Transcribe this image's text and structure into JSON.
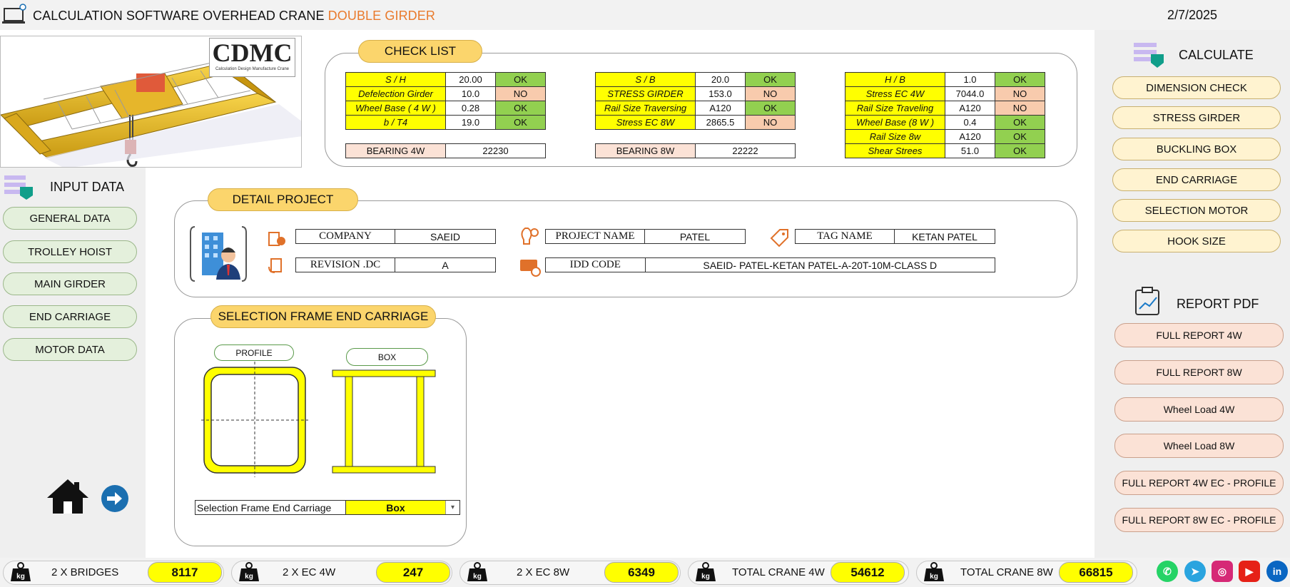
{
  "header": {
    "title_main": "CALCULATION SOFTWARE OVERHEAD CRANE ",
    "title_accent": "DOUBLE GIRDER",
    "date": "2/7/2025",
    "logo_text": "CDMC",
    "logo_subtext": "Calculation Design Manufacture Crane"
  },
  "checklist": {
    "heading": "CHECK LIST",
    "table1": [
      {
        "label": "S / H",
        "value": "20.00",
        "status": "OK"
      },
      {
        "label": "Defelection Girder",
        "value": "10.0",
        "status": "NO"
      },
      {
        "label": "Wheel Base ( 4 W )",
        "value": "0.28",
        "status": "OK"
      },
      {
        "label": "b / T4",
        "value": "19.0",
        "status": "OK"
      }
    ],
    "table2": [
      {
        "label": "S / B",
        "value": "20.0",
        "status": "OK"
      },
      {
        "label": "STRESS GIRDER",
        "value": "153.0",
        "status": "NO"
      },
      {
        "label": "Rail Size Traversing",
        "value": "A120",
        "status": "OK"
      },
      {
        "label": "Stress EC   8W",
        "value": "2865.5",
        "status": "NO"
      }
    ],
    "table3": [
      {
        "label": "H / B",
        "value": "1.0",
        "status": "OK"
      },
      {
        "label": "Stress EC   4W",
        "value": "7044.0",
        "status": "NO"
      },
      {
        "label": "Rail Size Traveling",
        "value": "A120",
        "status": "NO"
      },
      {
        "label": "Wheel Base (8 W )",
        "value": "0.4",
        "status": "OK"
      },
      {
        "label": "Rail Size 8w",
        "value": "A120",
        "status": "OK"
      },
      {
        "label": "Shear Strees",
        "value": "51.0",
        "status": "OK"
      }
    ],
    "bearing4w": {
      "label": "BEARING 4W",
      "value": "22230"
    },
    "bearing8w": {
      "label": "BEARING 8W",
      "value": "22222"
    }
  },
  "input_data": {
    "heading": "INPUT DATA",
    "buttons": [
      "GENERAL DATA",
      "TROLLEY HOIST",
      "MAIN GIRDER",
      "END CARRIAGE",
      "MOTOR DATA"
    ]
  },
  "calculate": {
    "heading": "CALCULATE",
    "buttons": [
      "DIMENSION CHECK",
      "STRESS GIRDER",
      "BUCKLING BOX",
      "END CARRIAGE",
      "SELECTION MOTOR",
      "HOOK SIZE"
    ]
  },
  "report": {
    "heading": "REPORT PDF",
    "buttons": [
      "FULL REPORT 4W",
      "FULL REPORT 8W",
      "Wheel Load 4W",
      "Wheel Load  8W",
      "FULL REPORT 4W  EC - PROFILE",
      "FULL REPORT 8W  EC - PROFILE"
    ]
  },
  "project": {
    "heading": "DETAIL PROJECT",
    "company_label": "COMPANY",
    "company_value": "SAEID",
    "revision_label": "REVISION .DC",
    "revision_value": "A",
    "project_name_label": "PROJECT NAME",
    "project_name_value": "PATEL",
    "idd_label": "IDD CODE",
    "idd_value": "SAEID- PATEL-KETAN PATEL-A-20T-10M-CLASS D",
    "tag_label": "TAG NAME",
    "tag_value": "KETAN PATEL"
  },
  "frame": {
    "heading": "SELECTION FRAME END CARRIAGE",
    "profile_label": "PROFILE",
    "box_label": "BOX",
    "select_label": "Selection Frame End Carriage",
    "select_value": "Box"
  },
  "bottom": [
    {
      "label": "2 X BRIDGES",
      "value": "8117",
      "unit": "kg"
    },
    {
      "label": "2 X EC 4W",
      "value": "247",
      "unit": "kg"
    },
    {
      "label": "2 X EC 8W",
      "value": "6349",
      "unit": "kg"
    },
    {
      "label": "TOTAL CRANE 4W",
      "value": "54612",
      "unit": "kg"
    },
    {
      "label": "TOTAL CRANE 8W",
      "value": "66815",
      "unit": "kg"
    }
  ],
  "colors": {
    "ok": "#92d050",
    "no": "#f8cbad",
    "label_yellow": "#ffff00",
    "heading": "#fbd56c",
    "accent_title": "#e97a2c"
  },
  "icons": [
    "laptop-icon",
    "home-icon",
    "next-arrow-icon",
    "whatsapp-icon",
    "telegram-icon",
    "instagram-icon",
    "youtube-icon",
    "linkedin-icon",
    "weight-icon"
  ]
}
